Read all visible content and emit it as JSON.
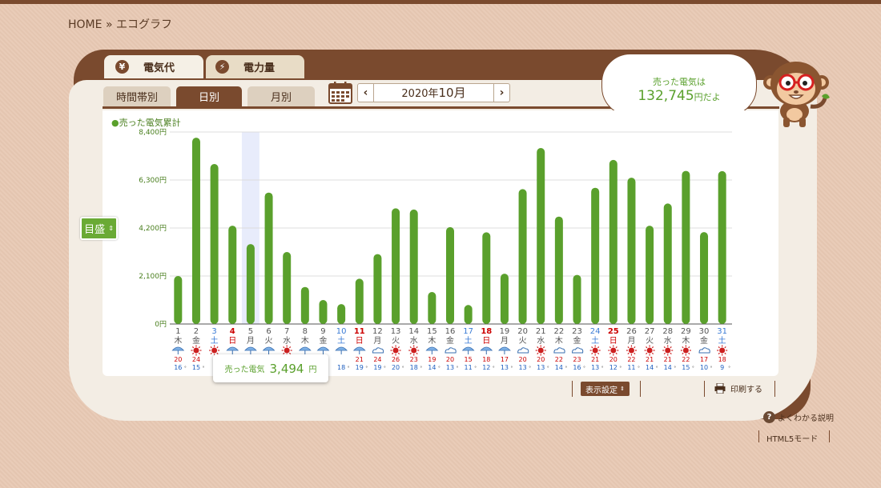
{
  "breadcrumb": {
    "home": "HOME",
    "sep": "»",
    "current": "エコグラフ"
  },
  "tabs": {
    "denki": "電気代",
    "denki_icon": "¥",
    "ryo": "電力量",
    "ryo_icon": "⚡"
  },
  "subtabs": {
    "time": "時間帯別",
    "day": "日別",
    "month": "月別"
  },
  "month_nav": {
    "year": "2020年",
    "month": "10月",
    "prev": "‹",
    "next": "›"
  },
  "bubble": {
    "line1": "売った電気は",
    "amount": "132,745",
    "unit": "円だよ"
  },
  "legend_title": "売った電気累計",
  "meyasu": "目盛",
  "tooltip": {
    "label": "売った電気",
    "value": "3,494",
    "unit": "円"
  },
  "footer": {
    "display_settings": "表示設定",
    "print": "印刷する",
    "help": "よくわかる説明",
    "html5": "HTML5モード"
  },
  "colors": {
    "bar": "#5aa02c",
    "highlight": "#e8ecfb",
    "saturday": "#3a7bd5",
    "sunday": "#cc0000",
    "high_temp": "#cc0000",
    "low_temp": "#2060c0"
  },
  "chart_data": {
    "type": "bar",
    "ylim": [
      0,
      8400
    ],
    "yticks": [
      "8,400円",
      "6,300円",
      "4,200円",
      "2,100円",
      "0円"
    ],
    "ytick_values": [
      8400,
      6300,
      4200,
      2100,
      0
    ],
    "highlight_index": 4,
    "days": [
      "1",
      "2",
      "3",
      "4",
      "5",
      "6",
      "7",
      "8",
      "9",
      "10",
      "11",
      "12",
      "13",
      "14",
      "15",
      "16",
      "17",
      "18",
      "19",
      "20",
      "21",
      "22",
      "23",
      "24",
      "25",
      "26",
      "27",
      "28",
      "29",
      "30",
      "31"
    ],
    "weekdays": [
      "木",
      "金",
      "土",
      "日",
      "月",
      "火",
      "水",
      "木",
      "金",
      "土",
      "日",
      "月",
      "火",
      "水",
      "木",
      "金",
      "土",
      "日",
      "月",
      "火",
      "水",
      "木",
      "金",
      "土",
      "日",
      "月",
      "火",
      "水",
      "木",
      "金",
      "土"
    ],
    "day_types": [
      "w",
      "w",
      "sat",
      "sun",
      "w",
      "w",
      "w",
      "w",
      "w",
      "sat",
      "sun",
      "w",
      "w",
      "w",
      "w",
      "w",
      "sat",
      "sun",
      "w",
      "w",
      "w",
      "w",
      "w",
      "sat",
      "sun",
      "w",
      "w",
      "w",
      "w",
      "w",
      "sat"
    ],
    "values": [
      2100,
      8150,
      7000,
      4300,
      3494,
      5750,
      3150,
      1620,
      1050,
      870,
      1980,
      3060,
      5060,
      5010,
      1400,
      4240,
      830,
      4010,
      2200,
      5900,
      7700,
      4700,
      2150,
      5960,
      7180,
      6400,
      4300,
      5270,
      6700,
      4020,
      6690
    ],
    "weather": [
      "rain",
      "sun",
      "sun",
      "rain",
      "rain",
      "rain",
      "sun",
      "rain",
      "rain",
      "rain",
      "rain",
      "cloud",
      "sun",
      "sun",
      "rain",
      "cloud",
      "rain",
      "rain",
      "rain",
      "cloud",
      "sun",
      "cloud",
      "cloud",
      "sun",
      "sun",
      "sun",
      "sun",
      "sun",
      "sun",
      "cloud",
      "sun"
    ],
    "high_temps": [
      "20",
      "24",
      "",
      "",
      "",
      "",
      "",
      "",
      "",
      "",
      "21",
      "24",
      "26",
      "23",
      "19",
      "20",
      "15",
      "18",
      "17",
      "20",
      "20",
      "22",
      "23",
      "21",
      "20",
      "22",
      "21",
      "21",
      "22",
      "17",
      "18"
    ],
    "low_temps": [
      "16",
      "15",
      "",
      "",
      "",
      "",
      "",
      "",
      "",
      "18",
      "19",
      "19",
      "20",
      "18",
      "14",
      "13",
      "11",
      "12",
      "13",
      "13",
      "13",
      "14",
      "16",
      "13",
      "12",
      "11",
      "14",
      "14",
      "15",
      "10",
      "9"
    ],
    "temp_unit": "°"
  }
}
